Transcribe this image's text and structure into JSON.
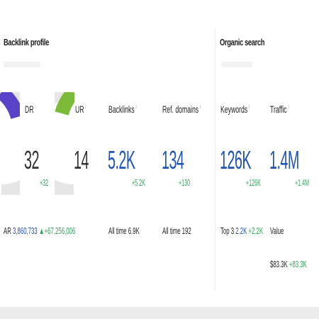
{
  "backlink_profile": {
    "title": "Backlink profile",
    "dr": {
      "label": "DR",
      "value": "32",
      "delta": "+32"
    },
    "ur": {
      "label": "UR",
      "value": "14"
    },
    "ar": {
      "label": "AR",
      "value": "3,860,733",
      "delta": "+67,256,006"
    },
    "backlinks": {
      "label": "Backlinks",
      "value": "5.2K",
      "delta": "+5.2K",
      "alltime_label": "All time",
      "alltime_value": "6.9K"
    },
    "ref_domains": {
      "label": "Ref. domains",
      "value": "134",
      "delta": "+130",
      "alltime_label": "All time",
      "alltime_value": "192"
    }
  },
  "organic_search": {
    "title": "Organic search",
    "keywords": {
      "label": "Keywords",
      "value": "126K",
      "delta": "+126K",
      "top3_label": "Top 3",
      "top3_value": "2.2K",
      "top3_delta": "+2.2K"
    },
    "traffic": {
      "label": "Traffic",
      "value": "1.4M",
      "delta": "+1.4M",
      "value_label": "Value",
      "value_value": "$83.3K",
      "value_delta": "+83.3K"
    }
  },
  "colors": {
    "dr_ring": "#5b43c9",
    "ur_ring": "#7cbb3a",
    "ring_bg": "#e6e6e6",
    "accent_blue": "#1f54b6",
    "positive_green": "#33a35b"
  },
  "icons": [
    "dr-gauge-icon",
    "ur-gauge-icon"
  ]
}
